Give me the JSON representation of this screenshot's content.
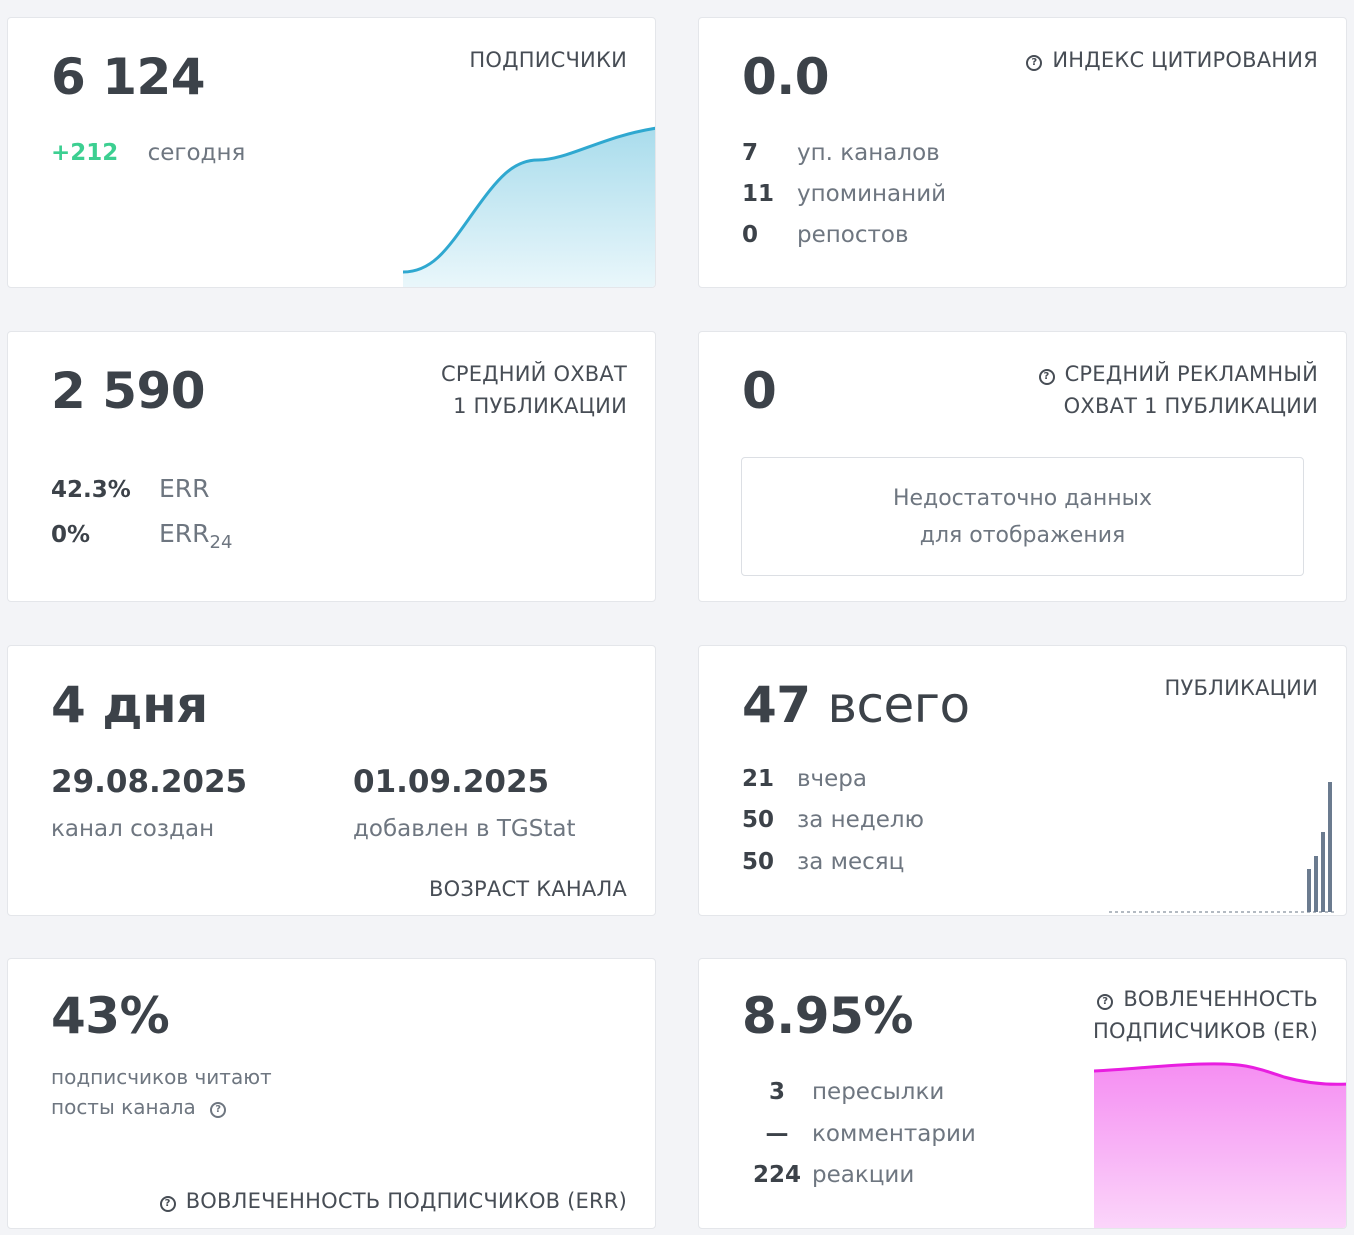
{
  "subscribers": {
    "value": "6 124",
    "caption": "ПОДПИСЧИКИ",
    "delta": "+212",
    "delta_label": "сегодня",
    "colors": {
      "line": "#2fa8d0",
      "fill_top": "#a9dcec",
      "fill_bottom": "#e8f6fb"
    }
  },
  "citation": {
    "value": "0.0",
    "caption": "ИНДЕКС ЦИТИРОВАНИЯ",
    "icon": "question-circle-icon",
    "rows": [
      {
        "num": "7",
        "label": "уп. каналов"
      },
      {
        "num": "11",
        "label": "упоминаний"
      },
      {
        "num": "0",
        "label": "репостов"
      }
    ]
  },
  "reach": {
    "value": "2 590",
    "caption_line1": "СРЕДНИЙ ОХВАТ",
    "caption_line2": "1 ПУБЛИКАЦИИ",
    "err_value": "42.3%",
    "err_label": "ERR",
    "err24_value": "0%",
    "err24_label": "ERR",
    "err24_sub": "24"
  },
  "ad_reach": {
    "value": "0",
    "caption_line1": "СРЕДНИЙ РЕКЛАМНЫЙ",
    "caption_line2": "ОХВАТ 1 ПУБЛИКАЦИИ",
    "icon": "question-circle-icon",
    "empty_line1": "Недостаточно данных",
    "empty_line2": "для отображения"
  },
  "age": {
    "value": "4 дня",
    "created_date": "29.08.2025",
    "created_label": "канал создан",
    "added_date": "01.09.2025",
    "added_label": "добавлен в TGStat",
    "caption": "ВОЗРАСТ КАНАЛА"
  },
  "posts": {
    "total_num": "47",
    "total_word": "всего",
    "caption": "ПУБЛИКАЦИИ",
    "rows": [
      {
        "num": "21",
        "label": "вчера"
      },
      {
        "num": "50",
        "label": "за неделю"
      },
      {
        "num": "50",
        "label": "за месяц"
      }
    ],
    "bar_color": "#6b7b8f"
  },
  "err_readers": {
    "value": "43%",
    "line1": "подписчиков читают",
    "line2": "посты канала",
    "caption": "ВОВЛЕЧЕННОСТЬ ПОДПИСЧИКОВ (ERR)",
    "icon": "question-circle-icon"
  },
  "er": {
    "value": "8.95%",
    "caption_line1": "ВОВЛЕЧЕННОСТЬ",
    "caption_line2": "ПОДПИСЧИКОВ (ER)",
    "icon": "question-circle-icon",
    "rows": [
      {
        "num": "3",
        "label": "пересылки"
      },
      {
        "num": "—",
        "label": "комментарии"
      },
      {
        "num": "224",
        "label": "реакции"
      }
    ],
    "colors": {
      "line": "#e81ee0",
      "fill_top": "#f58ef2",
      "fill_bottom": "#fbd3fa"
    }
  }
}
